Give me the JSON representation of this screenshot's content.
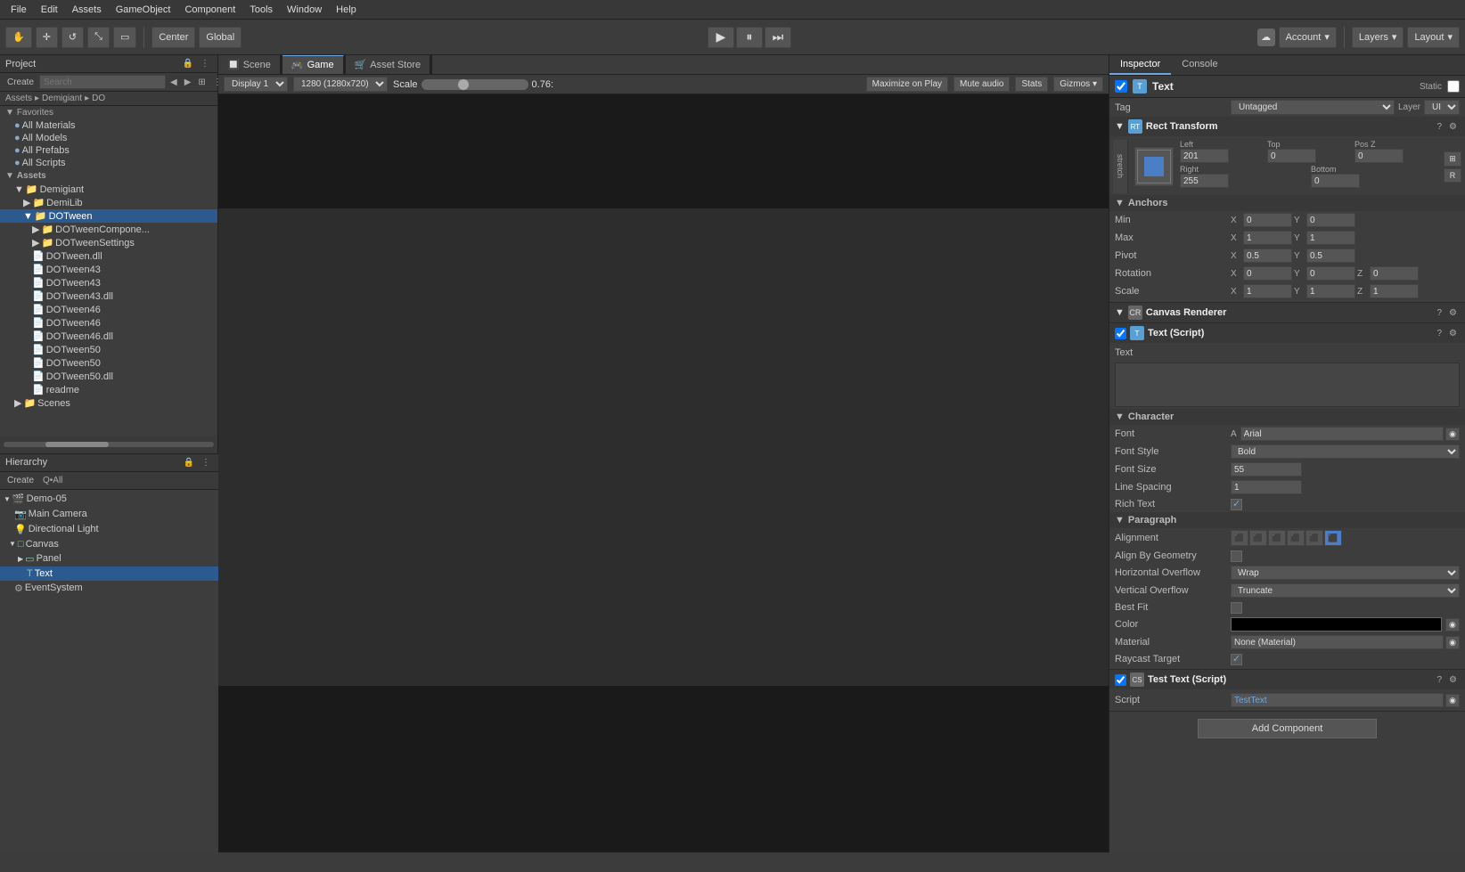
{
  "menuBar": {
    "items": [
      "File",
      "Edit",
      "Assets",
      "GameObject",
      "Component",
      "Tools",
      "Window",
      "Help"
    ]
  },
  "toolbar": {
    "tools": [
      "hand",
      "move",
      "rotate",
      "scale",
      "rect"
    ],
    "center": "Center",
    "global": "Global",
    "playBtn": "▶",
    "pauseBtn": "⏸",
    "stepBtn": "⏭",
    "cloud": "☁",
    "account": "Account",
    "layers": "Layers",
    "layout": "Layout"
  },
  "tabs": {
    "scene": "Scene",
    "game": "Game",
    "assetStore": "Asset Store"
  },
  "gameToolbar": {
    "display": "Display 1",
    "resolution": "1280 (1280x720)",
    "scaleLabel": "Scale",
    "scaleValue": "0.76:",
    "maximize": "Maximize on Play",
    "mute": "Mute audio",
    "stats": "Stats",
    "gizmos": "Gizmos"
  },
  "projectPanel": {
    "title": "Project",
    "createLabel": "Create",
    "searchPlaceholder": "Search",
    "breadcrumb": [
      "Assets",
      "Demigiant",
      "DO"
    ],
    "favorites": {
      "label": "Favorites",
      "items": [
        "All Materials",
        "All Models",
        "All Prefabs",
        "All Scripts"
      ]
    },
    "assets": {
      "label": "Assets",
      "items": [
        {
          "name": "Demigiant",
          "type": "folder",
          "indent": 1
        },
        {
          "name": "DemiLib",
          "type": "folder",
          "indent": 2
        },
        {
          "name": "DOTween",
          "type": "folder",
          "indent": 2,
          "selected": true
        },
        {
          "name": "DOTween.dll",
          "type": "file",
          "indent": 3
        },
        {
          "name": "DOTween43",
          "type": "file",
          "indent": 3
        },
        {
          "name": "DOTween43",
          "type": "file",
          "indent": 3
        },
        {
          "name": "DOTween43.dll",
          "type": "file",
          "indent": 3
        },
        {
          "name": "DOTween46",
          "type": "file",
          "indent": 3
        },
        {
          "name": "DOTween46",
          "type": "file",
          "indent": 3
        },
        {
          "name": "DOTween46.dll",
          "type": "file",
          "indent": 3
        },
        {
          "name": "DOTween50",
          "type": "file",
          "indent": 3
        },
        {
          "name": "DOTween50",
          "type": "file",
          "indent": 3
        },
        {
          "name": "DOTween50.dll",
          "type": "file",
          "indent": 3
        },
        {
          "name": "readme",
          "type": "file",
          "indent": 3
        }
      ],
      "subfolders": [
        {
          "name": "DOTweenComponent",
          "indent": 3
        },
        {
          "name": "DOTweenSettings",
          "indent": 3
        }
      ]
    }
  },
  "hierarchyPanel": {
    "title": "Hierarchy",
    "createLabel": "Create",
    "searchPlaceholder": "Q•All",
    "scene": "Demo-05",
    "items": [
      {
        "name": "Main Camera",
        "indent": 1,
        "icon": "camera"
      },
      {
        "name": "Directional Light",
        "indent": 1,
        "icon": "light"
      },
      {
        "name": "Canvas",
        "indent": 1,
        "icon": "canvas",
        "expanded": true
      },
      {
        "name": "Panel",
        "indent": 2,
        "icon": "panel"
      },
      {
        "name": "Text",
        "indent": 3,
        "icon": "text",
        "selected": true
      },
      {
        "name": "EventSystem",
        "indent": 1,
        "icon": "eventsystem"
      }
    ]
  },
  "inspector": {
    "title": "Inspector",
    "consoleBtnLabel": "Console",
    "objectName": "Text",
    "tag": "Untagged",
    "layer": "UI",
    "staticLabel": "Static",
    "sections": {
      "rectTransform": {
        "title": "Rect Transform",
        "stretchLabel": "stretch",
        "left": {
          "label": "Left",
          "value": "201"
        },
        "top": {
          "label": "Top",
          "value": "0"
        },
        "posZ": {
          "label": "Pos Z",
          "value": "0"
        },
        "right": {
          "label": "Right",
          "value": "255"
        },
        "bottom": {
          "label": "Bottom",
          "value": "0"
        },
        "anchors": {
          "title": "Anchors",
          "min": {
            "label": "Min",
            "x": "0",
            "y": "0"
          },
          "max": {
            "label": "Max",
            "x": "1",
            "y": "1"
          },
          "pivot": {
            "label": "Pivot",
            "x": "0.5",
            "y": "0.5"
          }
        },
        "rotation": {
          "label": "Rotation",
          "x": "0",
          "y": "0",
          "z": "0"
        },
        "scale": {
          "label": "Scale",
          "x": "1",
          "y": "1",
          "z": "1"
        }
      },
      "canvasRenderer": {
        "title": "Canvas Renderer"
      },
      "textScript": {
        "title": "Text (Script)",
        "textLabel": "Text",
        "textValue": "",
        "character": {
          "title": "Character",
          "font": {
            "label": "Font",
            "value": "Arial"
          },
          "fontStyle": {
            "label": "Font Style",
            "value": "Bold"
          },
          "fontSize": {
            "label": "Font Size",
            "value": "55"
          },
          "lineSpacing": {
            "label": "Line Spacing",
            "value": "1"
          },
          "richText": {
            "label": "Rich Text",
            "checked": true
          }
        },
        "paragraph": {
          "title": "Paragraph",
          "alignment": {
            "label": "Alignment"
          },
          "alignByGeometry": {
            "label": "Align By Geometry",
            "checked": false
          },
          "horizontalOverflow": {
            "label": "Horizontal Overflow",
            "value": "Wrap"
          },
          "verticalOverflow": {
            "label": "Vertical Overflow",
            "value": "Truncate"
          },
          "bestFit": {
            "label": "Best Fit",
            "checked": false
          }
        },
        "color": {
          "label": "Color",
          "value": "#000000"
        },
        "material": {
          "label": "Material",
          "value": "None (Material)"
        },
        "raycastTarget": {
          "label": "Raycast Target",
          "checked": true
        }
      },
      "testTextScript": {
        "title": "Test Text (Script)",
        "script": {
          "label": "Script",
          "value": "TestText"
        }
      }
    },
    "addComponent": "Add Component"
  }
}
